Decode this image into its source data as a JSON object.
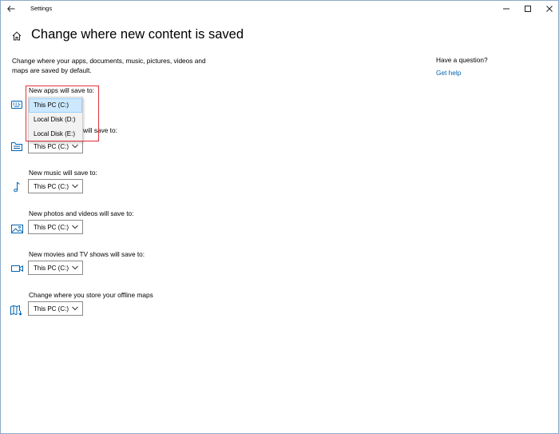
{
  "window": {
    "app_title": "Settings",
    "back_icon": "back-arrow-icon",
    "controls": [
      "minimize-icon",
      "maximize-icon",
      "close-icon"
    ]
  },
  "header": {
    "home_icon": "home-icon",
    "title": "Change where new content is saved"
  },
  "description": "Change where your apps, documents, music, pictures, videos and maps are saved by default.",
  "help": {
    "title": "Have a question?",
    "link": "Get help"
  },
  "sections": [
    {
      "label": "New apps will save to:",
      "value": "This PC (C:)",
      "icon": "apps-keyboard-icon"
    },
    {
      "label": "New documents will save to:",
      "label_visible": "will save to:",
      "value": "This PC (C:)",
      "icon": "documents-folder-icon"
    },
    {
      "label": "New music will save to:",
      "value": "This PC (C:)",
      "icon": "music-note-icon"
    },
    {
      "label": "New photos and videos will save to:",
      "value": "This PC (C:)",
      "icon": "photos-icon"
    },
    {
      "label": "New movies and TV shows will save to:",
      "value": "This PC (C:)",
      "icon": "video-camera-icon"
    },
    {
      "label": "Change where you store your offline maps",
      "value": "This PC (C:)",
      "icon": "offline-maps-icon"
    }
  ],
  "open_dropdown": {
    "options": [
      "This PC (C:)",
      "Local Disk (D:)",
      "Local Disk (E:)"
    ],
    "selected": "This PC (C:)"
  },
  "colors": {
    "accent": "#0063b1",
    "highlight_border": "#e0323a",
    "selected_option_bg": "#cce8ff"
  }
}
